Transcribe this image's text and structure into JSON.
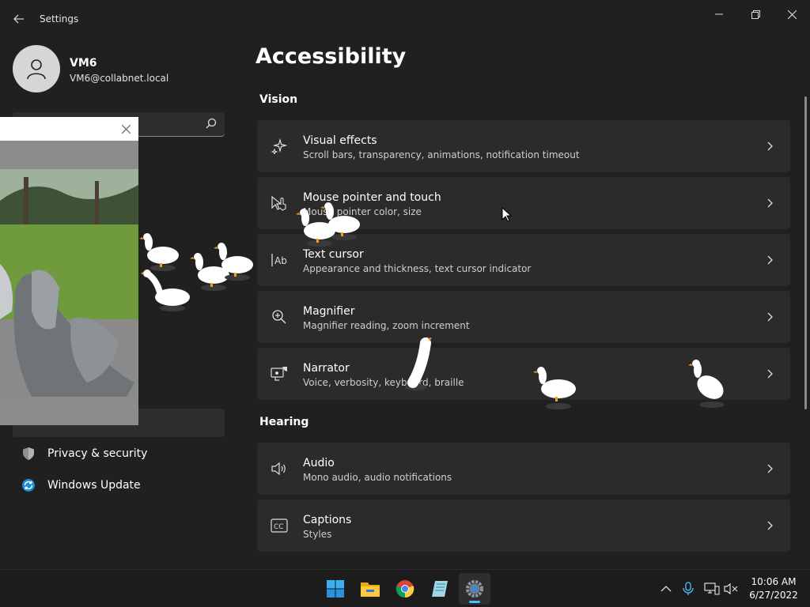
{
  "window": {
    "title": "Settings"
  },
  "user": {
    "name": "VM6",
    "email": "VM6@collabnet.local"
  },
  "sidebar": {
    "items": [
      {
        "label": "Privacy & security",
        "icon": "shield-icon"
      },
      {
        "label": "Windows Update",
        "icon": "windows-update-icon"
      }
    ]
  },
  "page": {
    "title": "Accessibility"
  },
  "sections": [
    {
      "title": "Vision",
      "cards": [
        {
          "title": "Visual effects",
          "desc": "Scroll bars, transparency, animations, notification timeout",
          "icon": "sparkle-icon"
        },
        {
          "title": "Mouse pointer and touch",
          "desc": "Mouse pointer color, size",
          "icon": "mouse-pointer-icon"
        },
        {
          "title": "Text cursor",
          "desc": "Appearance and thickness, text cursor indicator",
          "icon": "text-cursor-icon"
        },
        {
          "title": "Magnifier",
          "desc": "Magnifier reading, zoom increment",
          "icon": "magnifier-icon"
        },
        {
          "title": "Narrator",
          "desc": "Voice, verbosity, keyboard, braille",
          "icon": "narrator-icon"
        }
      ]
    },
    {
      "title": "Hearing",
      "cards": [
        {
          "title": "Audio",
          "desc": "Mono audio, audio notifications",
          "icon": "speaker-icon"
        },
        {
          "title": "Captions",
          "desc": "Styles",
          "icon": "captions-icon"
        }
      ]
    }
  ],
  "taskbar": {
    "apps": [
      "start-icon",
      "file-explorer-icon",
      "chrome-icon",
      "notepad-icon",
      "settings-icon"
    ],
    "clock": {
      "time": "10:06 AM",
      "date": "6/27/2022"
    }
  },
  "colors": {
    "background": "#202020",
    "card": "#2b2b2b",
    "accent": "#4cc2ff",
    "taskbar": "#1c1c1c"
  }
}
